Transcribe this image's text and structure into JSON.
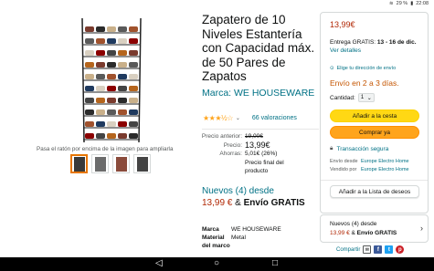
{
  "statusbar": {
    "time_left": "",
    "battery": "29 %",
    "time": "22:08"
  },
  "product": {
    "title": "Zapatero de 10 Niveles Estantería con Capacidad máx. de 50 Pares de Zapatos",
    "brand_link": "Marca: WE HOUSEWARE",
    "rating_stars": "★★★½☆",
    "ratings_count": "66 valoraciones",
    "zoom_hint": "Pasa el ratón por encima de la imagen para ampliarla",
    "thumbnails": [
      "thumb-1",
      "thumb-2",
      "thumb-3",
      "thumb-4"
    ],
    "price": {
      "prev_label": "Precio anterior:",
      "prev_value": "19,00€",
      "price_label": "Precio:",
      "price_value": "13,99€",
      "save_label": "Ahorras:",
      "save_value": "5,01€ (26%)",
      "final_note": "Precio final del producto"
    },
    "new_from": "Nuevos (4) desde",
    "new_price": "13,99 €",
    "new_amp": "&",
    "new_shipping": "Envío GRATIS",
    "details": [
      {
        "k": "Marca",
        "v": "WE HOUSEWARE"
      },
      {
        "k": "Material del marco",
        "v": "Metal"
      }
    ]
  },
  "buybox": {
    "price": "13,99€",
    "delivery_prefix": "Entrega GRATIS:",
    "delivery_date": "13 - 16 de dic.",
    "details_link": "Ver detalles",
    "location_link": "Elige tu dirección de envío",
    "stock": "Envío en 2 a 3 días.",
    "qty_label": "Cantidad:",
    "qty_value": "1",
    "add_to_cart": "Añadir a la cesta",
    "buy_now": "Comprar ya",
    "secure": "Transacción segura",
    "ship_from_label": "Envío desde",
    "ship_from_value": "Europe Electro Home",
    "sold_by_label": "Vendido por",
    "sold_by_value": "Europe Electro Home",
    "wishlist": "Añadir a la Lista de deseos"
  },
  "offers": {
    "line1": "Nuevos (4) desde",
    "price": "13,99 €",
    "amp": "&",
    "shipping": "Envío GRATIS"
  },
  "share": {
    "label": "Compartir"
  },
  "colors": {
    "accent": "#007185",
    "price": "#b12704",
    "cart": "#ffd814",
    "buy": "#ffa41c",
    "stock": "#c45500"
  }
}
